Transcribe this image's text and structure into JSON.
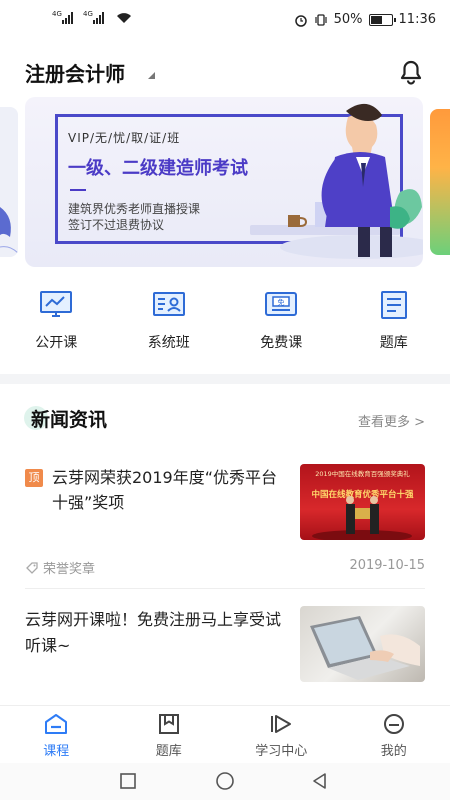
{
  "status_bar": {
    "signal1_label": "4G",
    "signal2_label": "4G",
    "battery": "50%",
    "battery_level": 0.5,
    "time": "11:36"
  },
  "header": {
    "title": "注册会计师"
  },
  "banner": {
    "kicker": "VIP/无/忧/取/证/班",
    "title": "一级、二级建造师考试",
    "line1": "建筑界优秀老师直播授课",
    "line2": "签订不过退费协议"
  },
  "quick_nav": [
    {
      "label": "公开课",
      "icon": "monitor-chart-icon"
    },
    {
      "label": "系统班",
      "icon": "profile-card-icon"
    },
    {
      "label": "免费课",
      "icon": "free-ticket-icon"
    },
    {
      "label": "题库",
      "icon": "question-bank-icon"
    }
  ],
  "news": {
    "section_title": "新闻资讯",
    "more": "查看更多 >",
    "items": [
      {
        "badge": "顶",
        "title": "云芽网荣获2019年度“优秀平台十强”奖项",
        "category": "荣誉奖章",
        "date": "2019-10-15",
        "image_caption_top": "2019中国在线教育百强颁奖典礼",
        "image_caption_main": "中国在线教育优秀平台十强"
      },
      {
        "title": "云芽网开课啦！免费注册马上享受试听课~"
      }
    ]
  },
  "tab_bar": [
    {
      "label": "课程",
      "icon": "course-icon",
      "active": true
    },
    {
      "label": "题库",
      "icon": "bookmark-book-icon",
      "active": false
    },
    {
      "label": "学习中心",
      "icon": "play-learning-icon",
      "active": false
    },
    {
      "label": "我的",
      "icon": "profile-face-icon",
      "active": false
    }
  ],
  "colors": {
    "accent": "#2e7cf6",
    "banner_purple": "#4b3bc6",
    "badge_orange": "#f08a4b"
  }
}
